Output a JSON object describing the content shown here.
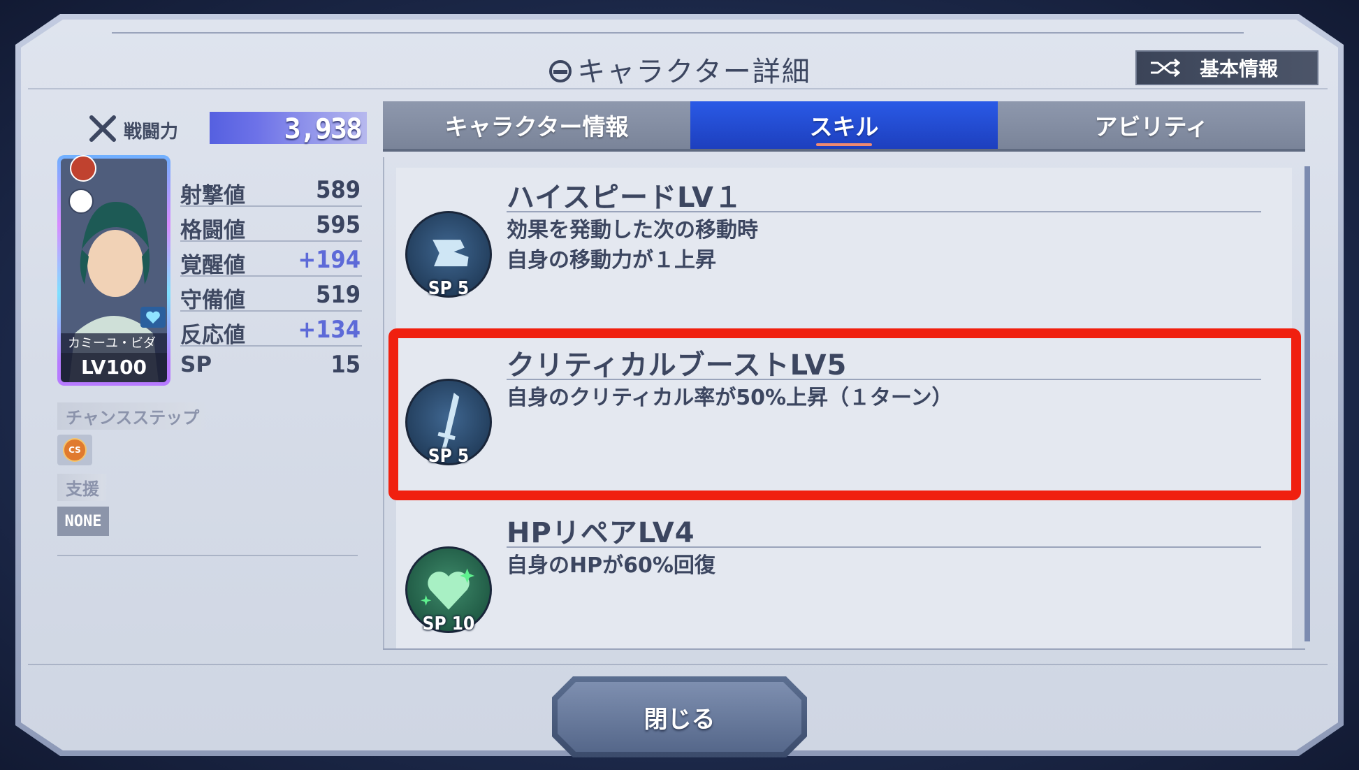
{
  "header": {
    "title": "キャラクター詳細",
    "basic_info_label": "基本情報"
  },
  "left": {
    "power_label": "戦闘力",
    "power_value": "3,938",
    "character": {
      "name": "カミーユ・ビダ",
      "level": "LV100"
    },
    "stats": [
      {
        "label": "射撃値",
        "value": "589"
      },
      {
        "label": "格闘値",
        "value": "595"
      },
      {
        "label": "覚醒値",
        "value": "+194"
      },
      {
        "label": "守備値",
        "value": "519"
      },
      {
        "label": "反応値",
        "value": "+134"
      },
      {
        "label": "SP",
        "value": "15"
      }
    ],
    "chance_step_label": "チャンスステップ",
    "chance_step_badge": "CS",
    "support_label": "支援",
    "support_value": "NONE"
  },
  "tabs": [
    {
      "label": "キャラクター情報",
      "active": false
    },
    {
      "label": "スキル",
      "active": true
    },
    {
      "label": "アビリティ",
      "active": false
    }
  ],
  "skills": [
    {
      "name": "ハイスピードLV１",
      "desc": "効果を発動した次の移動時\n自身の移動力が１上昇",
      "sp": "SP 5",
      "icon": "boot-icon"
    },
    {
      "name": "クリティカルブーストLV5",
      "desc": "自身のクリティカル率が50%上昇（１ターン）",
      "sp": "SP 5",
      "icon": "sword-icon"
    },
    {
      "name": "HPリペアLV4",
      "desc": "自身のHPが60%回復",
      "sp": "SP 10",
      "icon": "heart-icon"
    }
  ],
  "footer": {
    "close_label": "閉じる"
  },
  "colors": {
    "accent_tab": "#2a5ae6",
    "highlight": "#f0200f",
    "stat_bonus": "#5d6ad8"
  }
}
